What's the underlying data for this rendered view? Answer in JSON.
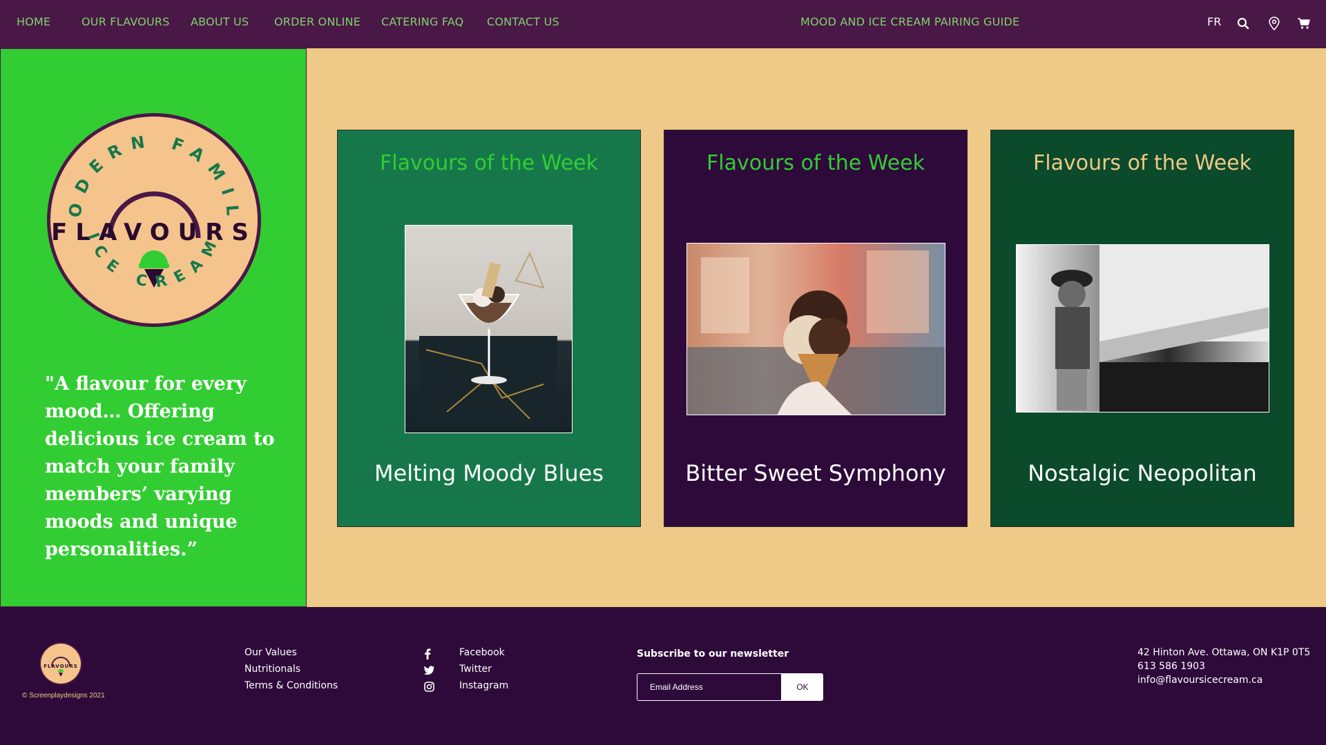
{
  "nav": {
    "links": [
      "HOME",
      "OUR FLAVOURS",
      "ABOUT US",
      "ORDER ONLINE",
      "CATERING FAQ",
      "CONTACT US"
    ],
    "guide": "MOOD AND ICE CREAM PAIRING GUIDE",
    "lang": "FR",
    "icons": [
      "search-icon",
      "location-pin-icon",
      "cart-icon"
    ]
  },
  "logo": {
    "top_arc": "MODERN FAMILY",
    "word": "FLAVOURS",
    "bottom_arc": "ICE CREAM"
  },
  "quote": "\"A flavour for every mood… Offering delicious ice cream to match your family members’ varying moods and unique personalities.”",
  "cards": [
    {
      "title": "Flavours of the Week",
      "name": "Melting Moody Blues",
      "bg": "#16784a",
      "title_color": "#32cd32"
    },
    {
      "title": "Flavours of the Week",
      "name": "Bitter Sweet Symphony",
      "bg": "#2e0a3a",
      "title_color": "#32cd32"
    },
    {
      "title": "Flavours of the Week",
      "name": "Nostalgic Neopolitan",
      "bg": "#0b4a2a",
      "title_color": "#efc987"
    }
  ],
  "footer": {
    "copyright": "© Screenplaydesigns 2021",
    "links": [
      "Our Values",
      "Nutritionals",
      "Terms & Conditions"
    ],
    "social": [
      {
        "label": "Facebook",
        "icon": "facebook-icon"
      },
      {
        "label": "Twitter",
        "icon": "twitter-icon"
      },
      {
        "label": "Instagram",
        "icon": "instagram-icon"
      }
    ],
    "newsletter_title": "Subscribe to our newsletter",
    "email_placeholder": "Email Address",
    "ok_label": "OK",
    "address": "42 Hinton Ave. Ottawa, ON K1P 0T5",
    "phone": "613 586 1903",
    "email": "info@flavoursicecream.ca"
  },
  "colors": {
    "nav_bg": "#4a1846",
    "nav_text": "#7fd36e",
    "green": "#32cd32",
    "cream": "#efc987",
    "purple": "#2e0a3a"
  }
}
